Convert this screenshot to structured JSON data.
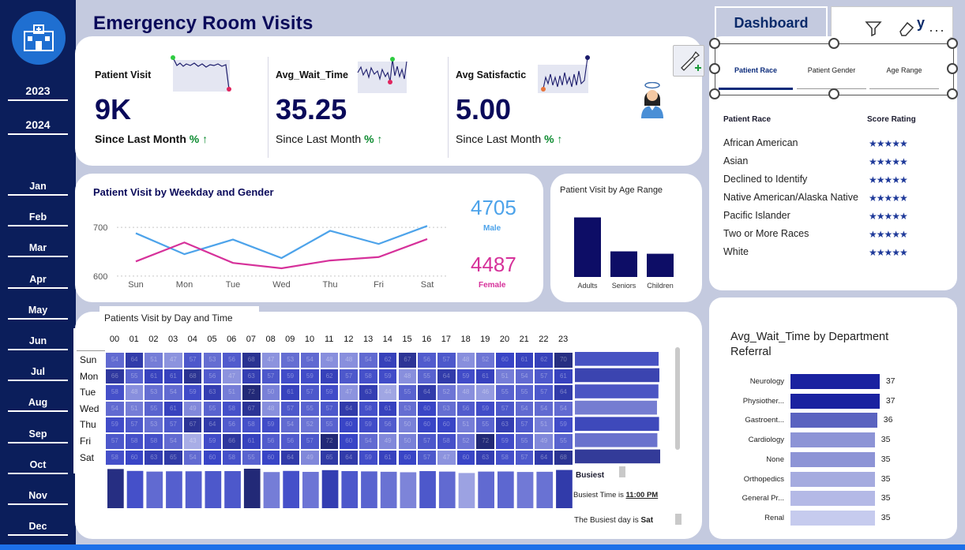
{
  "app": {
    "title": "Emergency Room Visits",
    "nav_button": "Dashboard",
    "nav_button_2": "y"
  },
  "sidebar": {
    "years": [
      "2023",
      "2024"
    ],
    "months": [
      "Jan",
      "Feb",
      "Mar",
      "Apr",
      "May",
      "Jun",
      "Jul",
      "Aug",
      "Sep",
      "Oct",
      "Nov",
      "Dec"
    ]
  },
  "kpis": [
    {
      "label": "Patient Visit",
      "value": "9K",
      "sub": "Since Last Month",
      "pct": "% ↑"
    },
    {
      "label": "Avg_Wait_Time",
      "value": "35.25",
      "sub": "Since Last Month",
      "pct": "% ↑"
    },
    {
      "label": "Avg Satisfactic",
      "value": "5.00",
      "sub": "Since Last Month",
      "pct": "% ↑"
    }
  ],
  "weekday_chart": {
    "title": "Patient Visit by Weekday and Gender",
    "male_total": "4705",
    "male_label": "Male",
    "female_total": "4487",
    "female_label": "Female",
    "colors": {
      "male": "#4da3ea",
      "female": "#d6319a"
    }
  },
  "age_chart": {
    "title": "Patient Visit by Age Range"
  },
  "heatmap": {
    "title": "Patients Visit by Day and Time",
    "busiest_label": "Busiest",
    "busiest_time_label": "Busiest Time is",
    "busiest_time": "11:00 PM",
    "busiest_day_label": "The Busiest day is",
    "busiest_day": "Sat"
  },
  "tabs": [
    "Patient Race",
    "Patient Gender",
    "Age Range"
  ],
  "race_table": {
    "headers": [
      "Patient Race",
      "Score Rating"
    ],
    "rows": [
      "African American",
      "Asian",
      "Declined to Identify",
      "Native American/Alaska Native",
      "Pacific Islander",
      "Two or More Races",
      "White"
    ],
    "stars": "★★★★★"
  },
  "dept_chart": {
    "title_line1": "Avg_Wait_Time by Department",
    "title_line2": "Referral"
  },
  "chart_data": [
    {
      "type": "line",
      "x": [
        "Sun",
        "Mon",
        "Tue",
        "Wed",
        "Thu",
        "Fri",
        "Sat"
      ],
      "yticks": [
        600,
        700
      ],
      "ylim": [
        590,
        710
      ],
      "series": [
        {
          "name": "Male",
          "values": [
            688,
            645,
            675,
            637,
            693,
            666,
            703
          ]
        },
        {
          "name": "Female",
          "values": [
            630,
            669,
            627,
            616,
            632,
            639,
            676
          ]
        }
      ]
    },
    {
      "type": "bar",
      "categories": [
        "Adults",
        "Seniors",
        "Children"
      ],
      "values": [
        5000,
        2150,
        1950
      ],
      "ylim": [
        0,
        5300
      ]
    },
    {
      "type": "heatmap",
      "x": [
        "00",
        "01",
        "02",
        "03",
        "04",
        "05",
        "06",
        "07",
        "08",
        "09",
        "10",
        "11",
        "12",
        "13",
        "14",
        "15",
        "16",
        "17",
        "18",
        "19",
        "20",
        "21",
        "22",
        "23"
      ],
      "y": [
        "Sun",
        "Mon",
        "Tue",
        "Wed",
        "Thu",
        "Fri",
        "Sat"
      ],
      "values": [
        [
          54,
          64,
          51,
          47,
          57,
          53,
          56,
          68,
          47,
          53,
          54,
          48,
          48,
          54,
          62,
          67,
          56,
          57,
          48,
          52,
          60,
          61,
          62,
          70
        ],
        [
          66,
          55,
          61,
          61,
          68,
          56,
          47,
          63,
          57,
          59,
          59,
          62,
          57,
          58,
          59,
          48,
          55,
          64,
          59,
          61,
          51,
          54,
          57,
          61
        ],
        [
          58,
          48,
          53,
          54,
          59,
          63,
          51,
          72,
          50,
          61,
          57,
          59,
          47,
          63,
          44,
          55,
          64,
          52,
          48,
          46,
          55,
          55,
          57,
          64
        ],
        [
          54,
          51,
          55,
          61,
          49,
          55,
          58,
          67,
          48,
          57,
          55,
          57,
          64,
          58,
          61,
          53,
          60,
          53,
          56,
          59,
          57,
          54,
          54,
          54
        ],
        [
          59,
          57,
          53,
          57,
          67,
          64,
          56,
          58,
          59,
          54,
          52,
          55,
          60,
          59,
          56,
          50,
          60,
          60,
          51,
          55,
          63,
          57,
          51,
          59
        ],
        [
          57,
          58,
          58,
          54,
          43,
          59,
          66,
          61,
          56,
          56,
          57,
          72,
          60,
          54,
          49,
          50,
          57,
          58,
          52,
          72,
          59,
          55,
          49,
          55
        ],
        [
          58,
          60,
          63,
          65,
          54,
          60,
          58,
          55,
          60,
          64,
          49,
          65,
          64,
          59,
          61,
          60,
          57,
          47,
          60,
          63,
          58,
          57,
          64,
          68
        ]
      ],
      "col_totals": [
        412,
        392,
        385,
        388,
        388,
        390,
        390,
        415,
        380,
        392,
        382,
        400,
        390,
        387,
        383,
        378,
        390,
        385,
        370,
        385,
        386,
        381,
        383,
        402
      ],
      "row_totals": [
        1338,
        1350,
        1335,
        1312,
        1345,
        1318,
        1363
      ]
    },
    {
      "type": "bar",
      "orientation": "horizontal",
      "categories": [
        "Neurology",
        "Physiother...",
        "Gastroent...",
        "Cardiology",
        "None",
        "Orthopedics",
        "General Pr...",
        "Renal"
      ],
      "values": [
        37,
        37,
        36,
        35,
        35,
        35,
        35,
        35
      ],
      "xlim": [
        0,
        40
      ]
    }
  ]
}
